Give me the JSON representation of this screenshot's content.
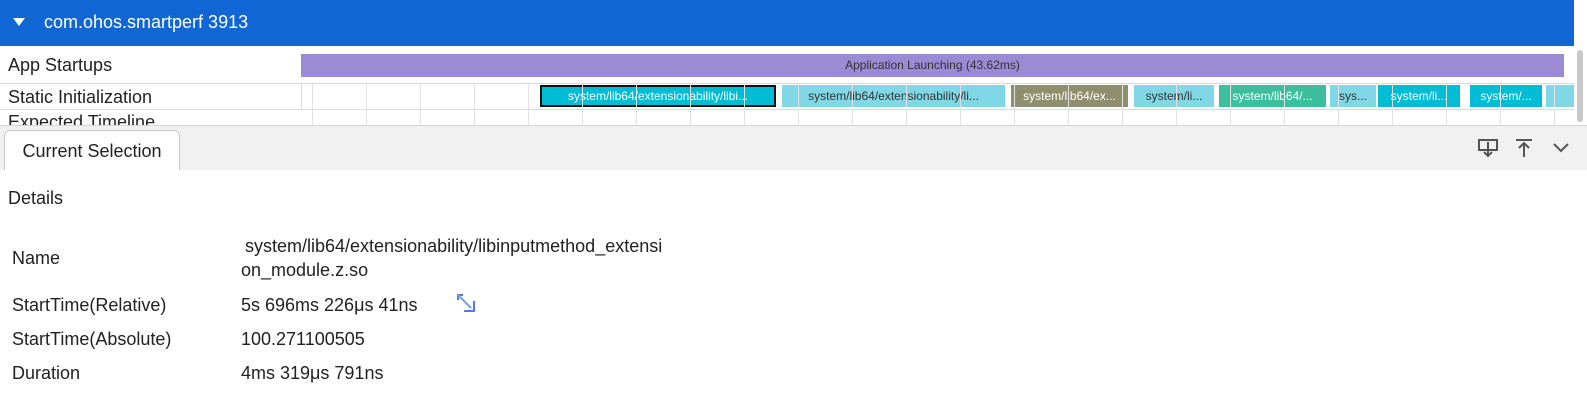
{
  "process": {
    "title": "com.ohos.smartperf 3913"
  },
  "rows": {
    "app_startups": "App Startups",
    "static_init": "Static Initialization",
    "expected_timeline": "Expected Timeline"
  },
  "launch_slice": {
    "label": "Application Launching (43.62ms)",
    "color": "#9b8ad4"
  },
  "static_slices": [
    {
      "label": "system/lib64/extensionability/libi...",
      "color": "#00bcd4",
      "text_color": "#ffffff",
      "selected": true
    },
    {
      "label": "system/lib64/extensionability/li...",
      "color": "#80d8e6",
      "text_color": "#333333"
    },
    {
      "label": "system/lib64/ex...",
      "color": "#8f8f6e",
      "text_color": "#ffffff"
    },
    {
      "label": "system/li...",
      "color": "#80d8e6",
      "text_color": "#333333"
    },
    {
      "label": "system/lib64/...",
      "color": "#3dbf9e",
      "text_color": "#ffffff"
    },
    {
      "label": "sys...",
      "color": "#80d8e6",
      "text_color": "#333333"
    },
    {
      "label": "system/li...",
      "color": "#00bcd4",
      "text_color": "#ffffff"
    },
    {
      "label": "system/...",
      "color": "#00bcd4",
      "text_color": "#ffffff"
    },
    {
      "label": "",
      "color": "#80d8e6",
      "text_color": "#333333"
    }
  ],
  "tabs": {
    "current_selection": "Current Selection"
  },
  "details": {
    "title": "Details",
    "name_key": "Name",
    "name_value_line1": "system/lib64/extensionability/libinputmethod_extensi",
    "name_value_line2": "on_module.z.so",
    "start_rel_key": "StartTime(Relative)",
    "start_rel_value": "5s 696ms 226μs 41ns",
    "start_abs_key": "StartTime(Absolute)",
    "start_abs_value": "100.271100505",
    "duration_key": "Duration",
    "duration_value": "4ms 319μs 791ns"
  },
  "icons": [
    "expand-triangle-icon",
    "download-icon",
    "upload-top-icon",
    "chevron-down-icon",
    "jump-link-icon"
  ]
}
